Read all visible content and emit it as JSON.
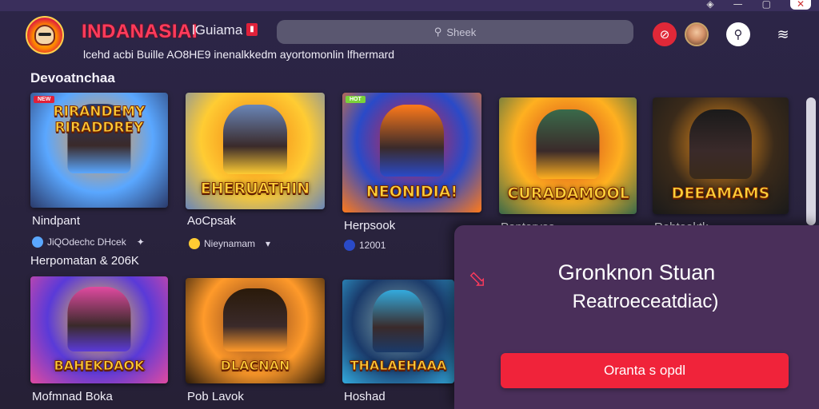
{
  "window": {
    "minimize": "—",
    "maximize": "▢",
    "close": "✕",
    "restore": "◈"
  },
  "header": {
    "brand": "INDANASIAI",
    "brand_sub": "lGuiama",
    "flag": "▮",
    "tagline": "lcehd acbi Buille AO8HE9 inenalkkedm ayortomonlin lfhermard",
    "search_placeholder": "Sheek"
  },
  "sections": [
    {
      "title": "Devoatnchaa"
    },
    {
      "title": "Herpomatan & 206K"
    }
  ],
  "cards": [
    {
      "top_art": "RIRANDEMY\nRIRADDREY",
      "title_art": "",
      "badge": "NEW",
      "badge_color": "#e0213a",
      "label": "Nindpant",
      "meta": "JiQOdechc DHcek",
      "meta_icon": "✦",
      "colors": [
        "#5aa7ff",
        "#ff9a2a",
        "#2a3a6a"
      ]
    },
    {
      "top_art": "",
      "title_art": "EHERUATHIN",
      "badge": "",
      "badge_color": "",
      "label": "AoCpsak",
      "meta": "Nieynamam",
      "meta_icon": "▾",
      "colors": [
        "#ffcc33",
        "#f07a10",
        "#6a86b8"
      ]
    },
    {
      "top_art": "",
      "title_art": "NEONIDIA!",
      "badge": "HOT",
      "badge_color": "#7ad23a",
      "label": "Herpsook",
      "meta": "12001",
      "meta_icon": "",
      "colors": [
        "#2a4ac8",
        "#e0213a",
        "#ff7a1a"
      ]
    },
    {
      "top_art": "",
      "title_art": "CURADAMOOL",
      "badge": "",
      "badge_color": "",
      "label": "Paptoryas",
      "meta": "",
      "meta_icon": "",
      "colors": [
        "#ffb020",
        "#d0401a",
        "#3a6a4a"
      ]
    },
    {
      "top_art": "",
      "title_art": "DEEAMAMS",
      "badge": "",
      "badge_color": "",
      "label": "Robtoaktk",
      "meta": "",
      "meta_icon": "",
      "colors": [
        "#3a2a1a",
        "#ff9a1a",
        "#1a1a1a"
      ]
    },
    {
      "top_art": "",
      "title_art": "BAHEKDAOK",
      "badge": "",
      "badge_color": "",
      "label": "Mofmnad Boka",
      "meta": "",
      "meta_icon": "",
      "colors": [
        "#5a3ad8",
        "#ffd23a",
        "#e04aa0"
      ]
    },
    {
      "top_art": "",
      "title_art": "DLACNAN",
      "badge": "",
      "badge_color": "",
      "label": "Pob Lavok",
      "meta": "",
      "meta_icon": "",
      "colors": [
        "#ff9a2a",
        "#7a3a1a",
        "#2a1a0a"
      ]
    },
    {
      "top_art": "",
      "title_art": "THALAEHAAA",
      "badge": "",
      "badge_color": "",
      "label": "Hoshad",
      "meta": "",
      "meta_icon": "",
      "colors": [
        "#1a3a6a",
        "#8aa",
        "#3ad"
      ]
    }
  ],
  "panel": {
    "title": "Gronknon Stuan",
    "subtitle": "Reatroeceatdiac)",
    "cta": "Oranta s opdl"
  }
}
